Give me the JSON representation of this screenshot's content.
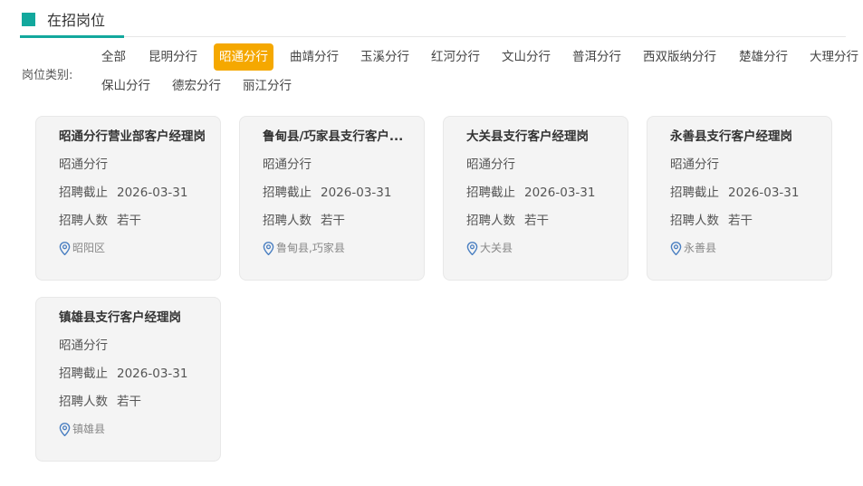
{
  "section": {
    "title": "在招岗位"
  },
  "filter": {
    "label": "岗位类别:",
    "tabs": [
      "全部",
      "昆明分行",
      "昭通分行",
      "曲靖分行",
      "玉溪分行",
      "红河分行",
      "文山分行",
      "普洱分行",
      "西双版纳分行",
      "楚雄分行",
      "大理分行",
      "保山分行",
      "德宏分行",
      "丽江分行"
    ],
    "active": "昭通分行"
  },
  "cards": [
    {
      "title": "昭通分行营业部客户经理岗",
      "branch": "昭通分行",
      "deadline_label": "招聘截止",
      "deadline": "2026-03-31",
      "count_label": "招聘人数",
      "count": "若干",
      "location": "昭阳区"
    },
    {
      "title": "鲁甸县/巧家县支行客户...",
      "branch": "昭通分行",
      "deadline_label": "招聘截止",
      "deadline": "2026-03-31",
      "count_label": "招聘人数",
      "count": "若干",
      "location": "鲁甸县,巧家县"
    },
    {
      "title": "大关县支行客户经理岗",
      "branch": "昭通分行",
      "deadline_label": "招聘截止",
      "deadline": "2026-03-31",
      "count_label": "招聘人数",
      "count": "若干",
      "location": "大关县"
    },
    {
      "title": "永善县支行客户经理岗",
      "branch": "昭通分行",
      "deadline_label": "招聘截止",
      "deadline": "2026-03-31",
      "count_label": "招聘人数",
      "count": "若干",
      "location": "永善县"
    },
    {
      "title": "镇雄县支行客户经理岗",
      "branch": "昭通分行",
      "deadline_label": "招聘截止",
      "deadline": "2026-03-31",
      "count_label": "招聘人数",
      "count": "若干",
      "location": "镇雄县"
    }
  ],
  "colors": {
    "accent": "#12a89d",
    "active_tab": "#f5a800",
    "pin": "#4a7fc1"
  },
  "icons": {
    "section_marker": "square-marker-icon",
    "location": "location-pin-icon"
  }
}
